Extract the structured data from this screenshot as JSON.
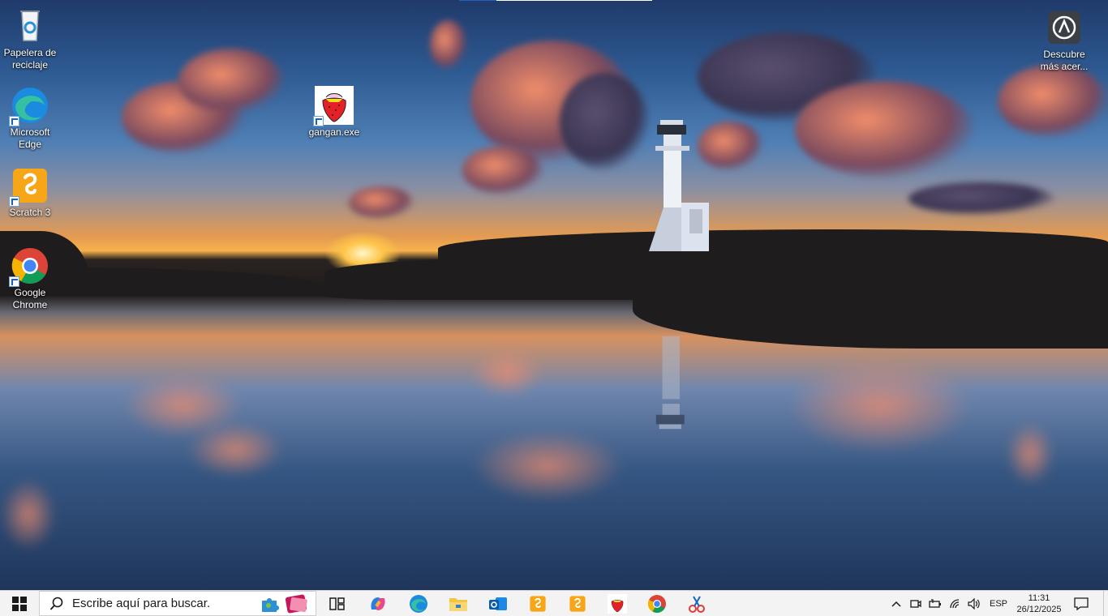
{
  "desktop": {
    "icons": [
      {
        "label": "Papelera de reciclaje",
        "icon": "recycle-bin-icon"
      },
      {
        "label": "Microsoft Edge",
        "icon": "edge-icon"
      },
      {
        "label": "Scratch 3",
        "icon": "scratch-icon"
      },
      {
        "label": "Google Chrome",
        "icon": "chrome-icon"
      },
      {
        "label": "gangan.exe",
        "icon": "strawberry-icon"
      },
      {
        "label": "Descubre más acer...",
        "icon": "discover-icon"
      }
    ]
  },
  "taskbar": {
    "search_placeholder": "Escribe aquí para buscar.",
    "apps": [
      {
        "name": "task-view",
        "icon": "task-view-icon"
      },
      {
        "name": "copilot",
        "icon": "copilot-icon"
      },
      {
        "name": "edge",
        "icon": "edge-icon"
      },
      {
        "name": "file-explorer",
        "icon": "folder-icon"
      },
      {
        "name": "outlook",
        "icon": "outlook-icon"
      },
      {
        "name": "scratch",
        "icon": "scratch-icon"
      },
      {
        "name": "scratch-2",
        "icon": "scratch-icon"
      },
      {
        "name": "gangan",
        "icon": "strawberry-icon"
      },
      {
        "name": "chrome",
        "icon": "chrome-icon"
      },
      {
        "name": "snipping-tool",
        "icon": "snipping-tool-icon"
      }
    ],
    "tray": {
      "language": "ESP",
      "time": "11:31",
      "date": "26/12/2025"
    }
  },
  "colors": {
    "taskbar_bg": "#f3f3f3",
    "accent": "#0078d4"
  }
}
